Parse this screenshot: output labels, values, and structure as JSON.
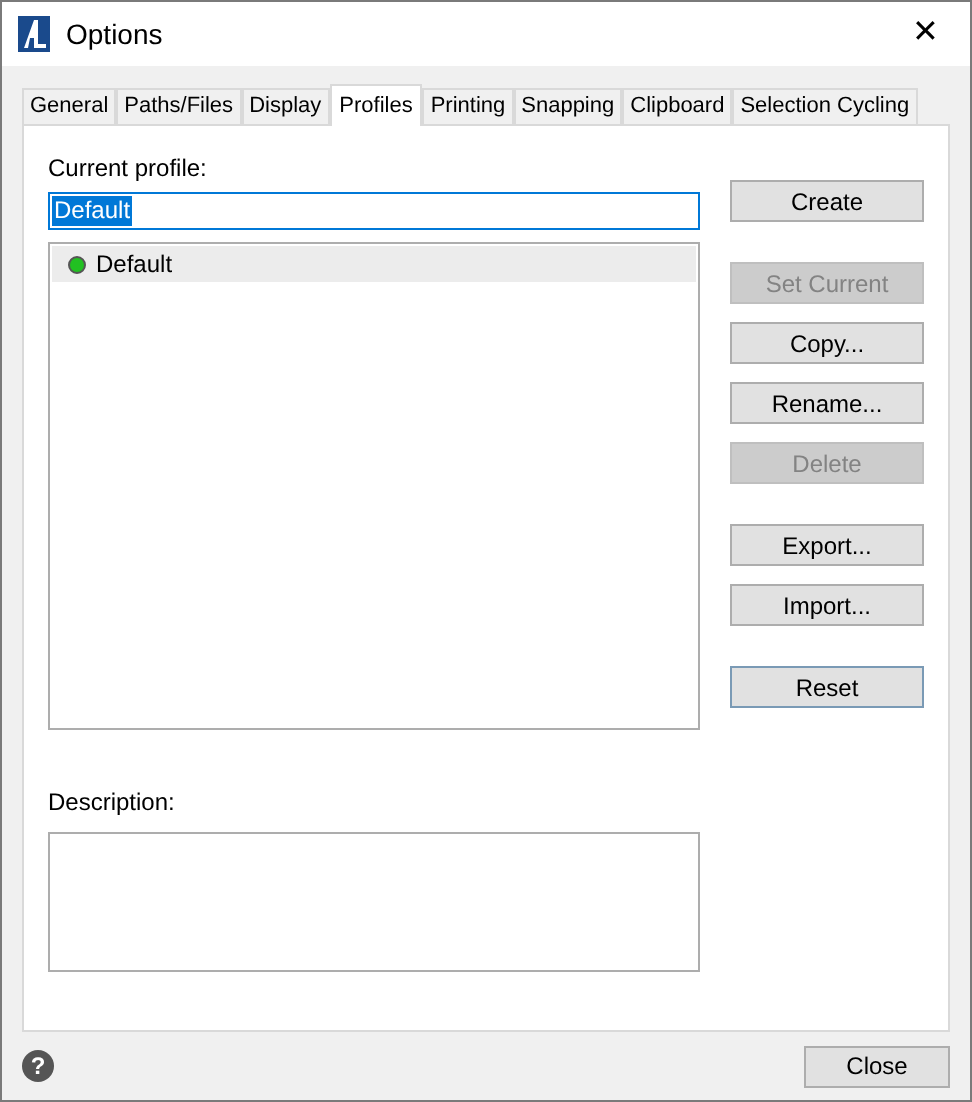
{
  "window": {
    "title": "Options",
    "close": "✕"
  },
  "tabs": [
    {
      "label": "General",
      "selected": false
    },
    {
      "label": "Paths/Files",
      "selected": false
    },
    {
      "label": "Display",
      "selected": false
    },
    {
      "label": "Profiles",
      "selected": true
    },
    {
      "label": "Printing",
      "selected": false
    },
    {
      "label": "Snapping",
      "selected": false
    },
    {
      "label": "Clipboard",
      "selected": false
    },
    {
      "label": "Selection Cycling",
      "selected": false
    }
  ],
  "current_profile": {
    "label": "Current profile:",
    "value": "Default"
  },
  "profiles": [
    {
      "name": "Default",
      "selected": true,
      "color": "#22c022"
    }
  ],
  "description": {
    "label": "Description:"
  },
  "button_groups": [
    [
      {
        "label": "Create",
        "disabled": false,
        "default": false
      }
    ],
    [
      {
        "label": "Set Current",
        "disabled": true,
        "default": false
      },
      {
        "label": "Copy...",
        "disabled": false,
        "default": false
      },
      {
        "label": "Rename...",
        "disabled": false,
        "default": false
      },
      {
        "label": "Delete",
        "disabled": true,
        "default": false
      }
    ],
    [
      {
        "label": "Export...",
        "disabled": false,
        "default": false
      },
      {
        "label": "Import...",
        "disabled": false,
        "default": false
      }
    ],
    [
      {
        "label": "Reset",
        "disabled": false,
        "default": true
      }
    ]
  ],
  "footer": {
    "help": "?",
    "close": "Close"
  }
}
